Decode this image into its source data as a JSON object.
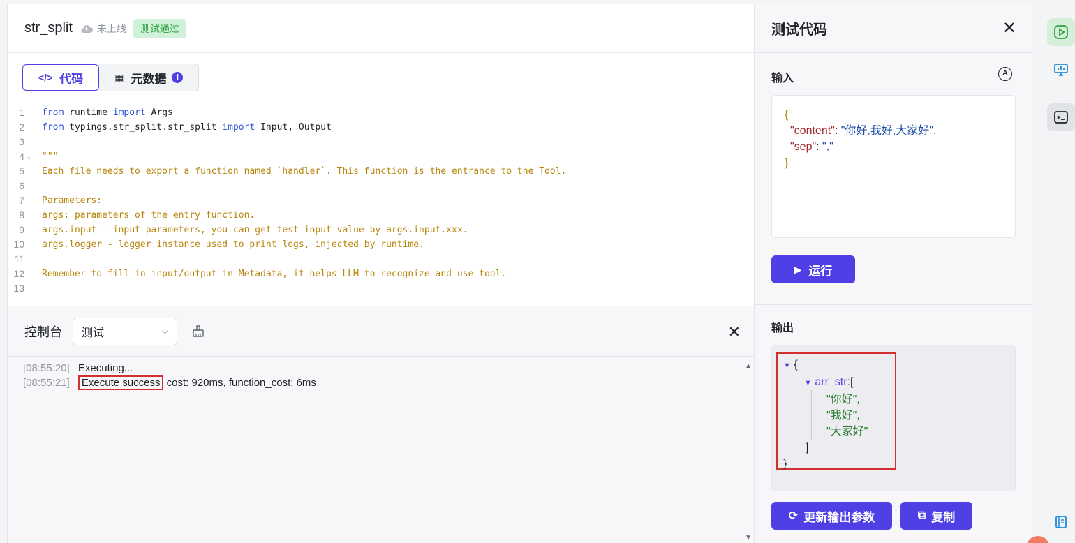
{
  "header": {
    "tool_name": "str_split",
    "status": "未上线",
    "badge": "测试通过"
  },
  "tabs": [
    {
      "icon": "</>",
      "label": "代码"
    },
    {
      "icon": "▦",
      "label": "元数据"
    }
  ],
  "code_lines": [
    {
      "n": "1",
      "parts": [
        {
          "t": "from",
          "c": "kw"
        },
        {
          "t": " runtime "
        },
        {
          "t": "import",
          "c": "kw"
        },
        {
          "t": " Args"
        }
      ]
    },
    {
      "n": "2",
      "parts": [
        {
          "t": "from",
          "c": "kw"
        },
        {
          "t": " typings.str_split.str_split "
        },
        {
          "t": "import",
          "c": "kw"
        },
        {
          "t": " Input, Output"
        }
      ]
    },
    {
      "n": "3",
      "parts": []
    },
    {
      "n": "4",
      "fold": true,
      "parts": [
        {
          "t": "\"\"\"",
          "c": "cm"
        }
      ]
    },
    {
      "n": "5",
      "parts": [
        {
          "t": "Each file needs to export a function named `handler`. This function is the entrance to the Tool.",
          "c": "cm"
        }
      ]
    },
    {
      "n": "6",
      "parts": []
    },
    {
      "n": "7",
      "parts": [
        {
          "t": "Parameters:",
          "c": "cm"
        }
      ]
    },
    {
      "n": "8",
      "parts": [
        {
          "t": "args: parameters of the entry function.",
          "c": "cm"
        }
      ]
    },
    {
      "n": "9",
      "parts": [
        {
          "t": "args.input - input parameters, you can get test input value by args.input.xxx.",
          "c": "cm"
        }
      ]
    },
    {
      "n": "10",
      "parts": [
        {
          "t": "args.logger - logger instance used to print logs, injected by runtime.",
          "c": "cm"
        }
      ]
    },
    {
      "n": "11",
      "parts": []
    },
    {
      "n": "12",
      "parts": [
        {
          "t": "Remember to fill in input/output in Metadata, it helps LLM to recognize and use tool.",
          "c": "cm"
        }
      ]
    },
    {
      "n": "13",
      "parts": []
    }
  ],
  "console": {
    "title": "控制台",
    "select_value": "测试",
    "logs": [
      {
        "time": "[08:55:20]",
        "msg": "Executing...",
        "extra": ""
      },
      {
        "time": "[08:55:21]",
        "msg": "Execute success",
        "extra": "cost: 920ms, function_cost: 6ms"
      }
    ]
  },
  "test_panel": {
    "title": "测试代码",
    "input_label": "输入",
    "input_json": {
      "open": "{",
      "close": "}",
      "rows": [
        {
          "key": "\"content\"",
          "value": "\"你好,我好,大家好\","
        },
        {
          "key": "\"sep\"",
          "value": "\",\""
        }
      ]
    },
    "run_label": "运行",
    "output_label": "输出",
    "output_json": {
      "open": "{",
      "key": "arr_str:",
      "bracket_open": "[",
      "items": [
        "\"你好\",",
        "\"我好\",",
        "\"大家好\""
      ],
      "bracket_close": "]",
      "close": "}"
    },
    "update_label": "更新输出参数",
    "copy_label": "复制"
  },
  "colors": {
    "accent": "#4e40e5",
    "highlight_box": "#d32f2f",
    "success_badge_bg": "#d2f1da"
  }
}
